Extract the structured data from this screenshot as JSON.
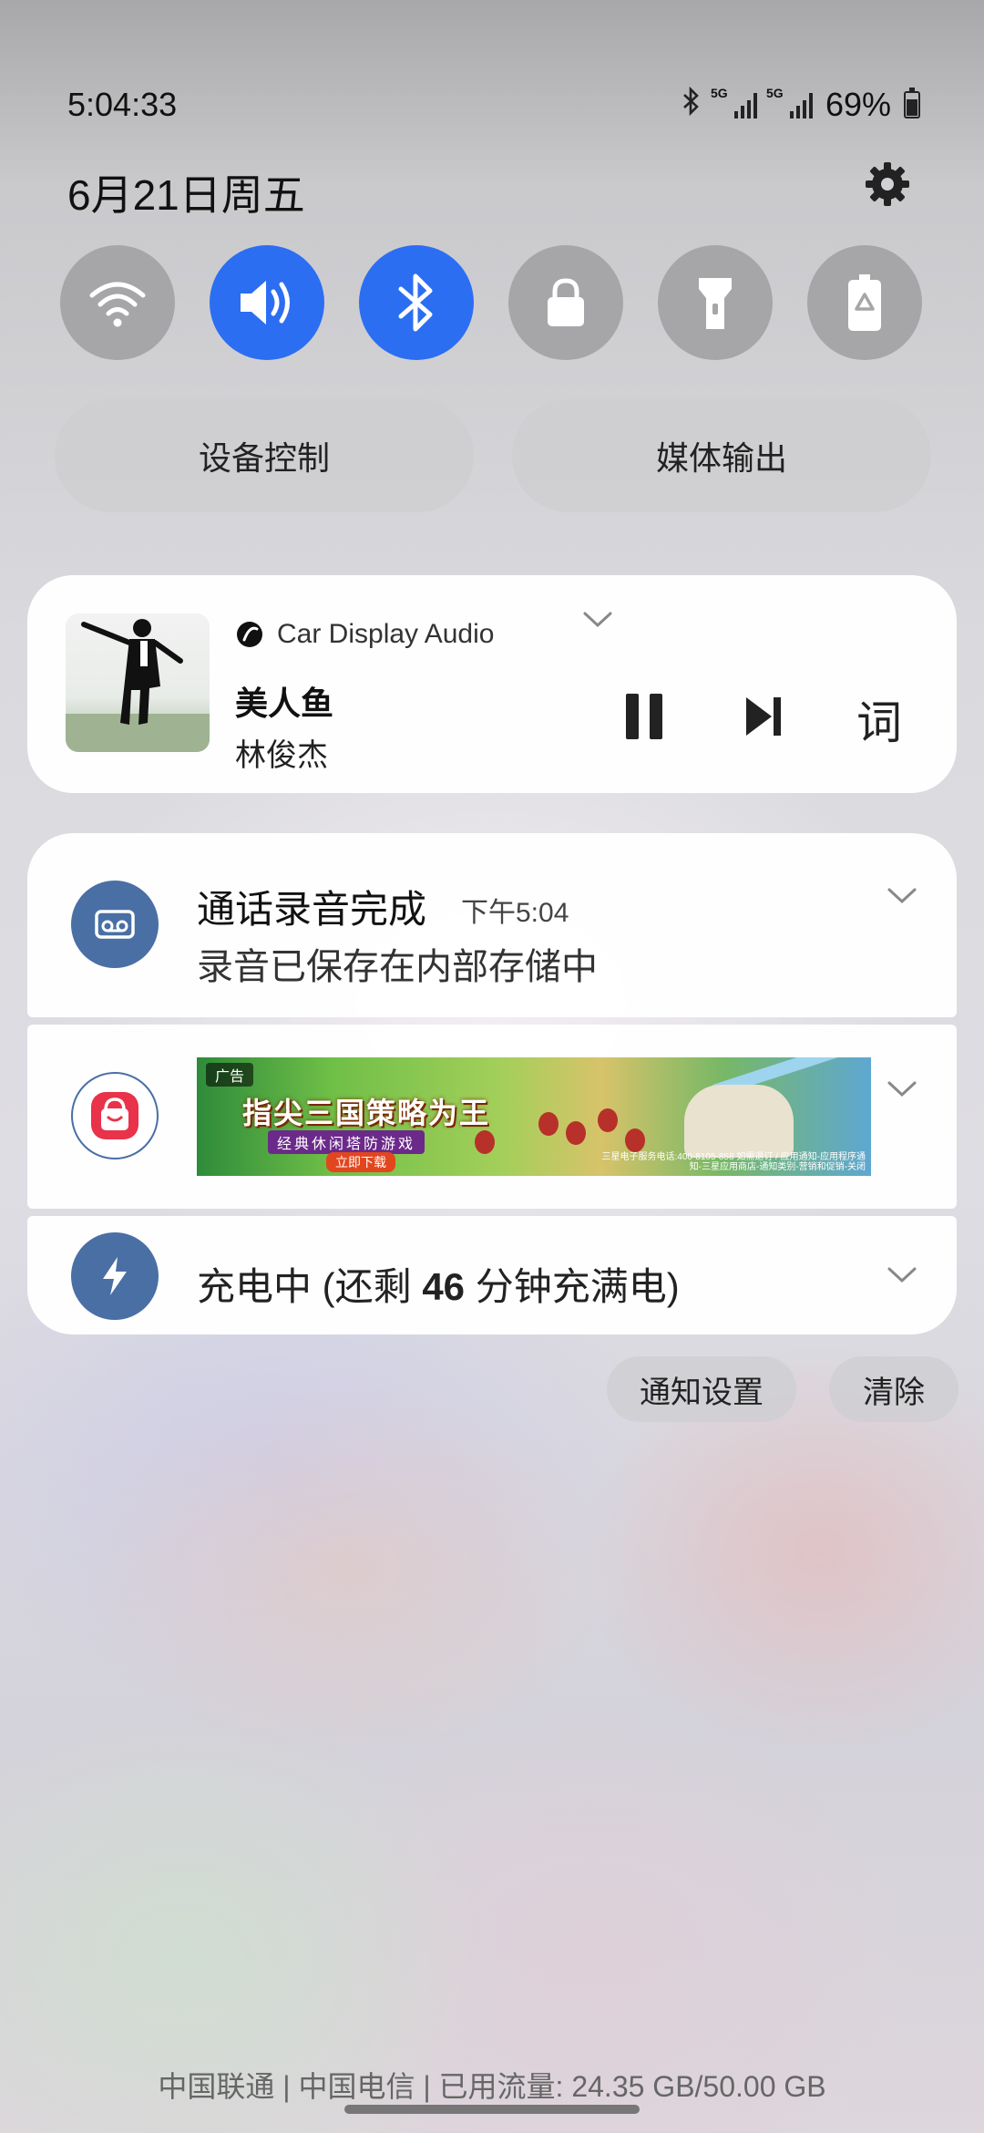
{
  "status_bar": {
    "time": "5:04:33",
    "sim1_label": "5G",
    "sim2_label": "5G",
    "battery": "69%",
    "icons": [
      "bluetooth-icon",
      "signal-icon",
      "signal-icon",
      "battery-charging-icon"
    ]
  },
  "header": {
    "date": "6月21日周五",
    "settings_icon": "gear-icon"
  },
  "quick_settings": [
    {
      "name": "wifi",
      "icon": "wifi-icon",
      "active": false
    },
    {
      "name": "sound",
      "icon": "volume-icon",
      "active": true
    },
    {
      "name": "bluetooth",
      "icon": "bluetooth-icon",
      "active": true
    },
    {
      "name": "lock",
      "icon": "lock-icon",
      "active": false
    },
    {
      "name": "flashlight",
      "icon": "flashlight-icon",
      "active": false
    },
    {
      "name": "power-saving",
      "icon": "battery-recycle-icon",
      "active": false
    }
  ],
  "pills": {
    "device_control": "设备控制",
    "media_output": "媒体输出"
  },
  "media": {
    "source": "Car Display Audio",
    "song": "美人鱼",
    "artist": "林俊杰",
    "lyrics_label": "词"
  },
  "notifications": {
    "call_recording": {
      "title": "通话录音完成",
      "time": "下午5:04",
      "body": "录音已保存在内部存储中"
    },
    "ad": {
      "tag": "广告",
      "headline": "指尖三国策略为王",
      "subline": "经典休闲塔防游戏",
      "cta": "立即下载",
      "fine_print": "三星电子服务电话:400-8105-858 如需退订 / 应用通知-应用程序通知-三星应用商店-通知类别-营销和促销-关闭"
    },
    "charging": {
      "text": "充电中 (还剩 46 分钟充满电)",
      "before": "充电中 (还剩 ",
      "minutes": "46",
      "after": " 分钟充满电)"
    }
  },
  "actions": {
    "notification_settings": "通知设置",
    "clear": "清除"
  },
  "footer": {
    "carrier_info": "中国联通 | 中国电信 | 已用流量: 24.35 GB/50.00 GB"
  },
  "colors": {
    "accent": "#2c6ef2",
    "app_icon_blue": "#4a6fa5",
    "shop_red": "#e8334a"
  }
}
